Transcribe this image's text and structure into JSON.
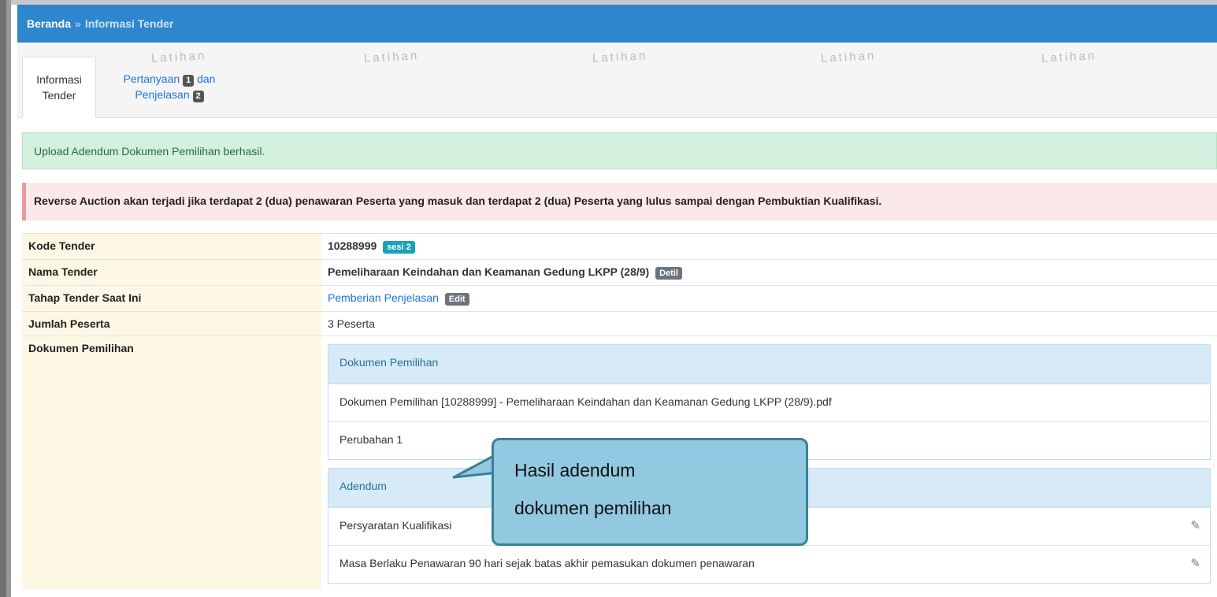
{
  "breadcrumb": {
    "home": "Beranda",
    "separator": "»",
    "current": "Informasi Tender"
  },
  "watermark": "Latihan",
  "tabs": {
    "active_line1": "Informasi",
    "active_line2": "Tender",
    "link_part1": "Pertanyaan",
    "badge1": "1",
    "link_part2": "dan",
    "link_part3": "Penjelasan",
    "badge2": "2"
  },
  "alerts": {
    "success": "Upload Adendum Dokumen Pemilihan berhasil.",
    "danger": "Reverse Auction akan terjadi jika terdapat 2 (dua) penawaran Peserta yang masuk dan terdapat 2 (dua) Peserta yang lulus sampai dengan Pembuktian Kualifikasi."
  },
  "info": {
    "kode_label": "Kode Tender",
    "kode_value": "10288999",
    "kode_badge": "sesi 2",
    "nama_label": "Nama Tender",
    "nama_value": "Pemeliharaan Keindahan dan Keamanan Gedung LKPP (28/9)",
    "nama_button": "Detil",
    "tahap_label": "Tahap Tender Saat Ini",
    "tahap_value": "Pemberian Penjelasan",
    "tahap_button": "Edit",
    "jumlah_label": "Jumlah Peserta",
    "jumlah_value": "3 Peserta",
    "dokumen_label": "Dokumen Pemilihan"
  },
  "dokumen_panel": {
    "heading": "Dokumen Pemilihan",
    "items": [
      "Dokumen Pemilihan [10288999] - Pemeliharaan Keindahan dan Keamanan Gedung LKPP (28/9).pdf",
      "Perubahan 1"
    ]
  },
  "adendum_panel": {
    "heading": "Adendum",
    "items": [
      "Persyaratan Kualifikasi",
      "Masa Berlaku Penawaran 90 hari sejak batas akhir pemasukan dokumen penawaran"
    ]
  },
  "callout": {
    "line1": "Hasil adendum",
    "line2": "dokumen pemilihan"
  },
  "icons": {
    "edit": "edit-icon"
  },
  "colors": {
    "header": "#2e86cf",
    "success_bg": "#d4f0df",
    "danger_bg": "#fbe9ea",
    "label_bg": "#fcf8e3",
    "badge_info": "#17a2b8",
    "callout_bg": "#92c9e0"
  }
}
